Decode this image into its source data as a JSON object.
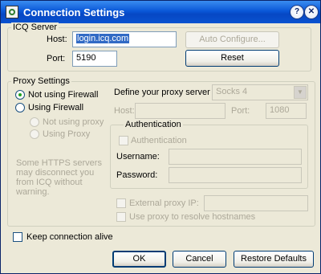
{
  "window": {
    "title": "Connection Settings",
    "help_glyph": "?",
    "close_glyph": "✕"
  },
  "icq_server": {
    "legend": "ICQ Server",
    "host_label": "Host:",
    "host_value": "login.icq.com",
    "port_label": "Port:",
    "port_value": "5190",
    "auto_configure_label": "Auto Configure...",
    "reset_label": "Reset"
  },
  "proxy_settings": {
    "legend": "Proxy Settings",
    "not_using_firewall": "Not using Firewall",
    "using_firewall": "Using Firewall",
    "not_using_proxy": "Not using proxy",
    "using_proxy": "Using Proxy",
    "note": "Some HTTPS servers may disconnect you from ICQ without warning.",
    "define_label": "Define your proxy server",
    "proxy_type": "Socks 4",
    "host_label": "Host:",
    "host_value": "",
    "port_label": "Port:",
    "port_value": "1080",
    "auth": {
      "legend": "Authentication",
      "checkbox_label": "Authentication",
      "username_label": "Username:",
      "password_label": "Password:"
    },
    "external_proxy_ip_label": "External proxy IP:",
    "use_proxy_resolve_label": "Use proxy to resolve hostnames"
  },
  "keep_alive_label": "Keep connection alive",
  "buttons": {
    "ok": "OK",
    "cancel": "Cancel",
    "restore_defaults": "Restore Defaults"
  },
  "colors": {
    "titlebar": "#0a58d8",
    "window_bg": "#ece9d8",
    "selection": "#316ac5",
    "radio_dot": "#21a121"
  }
}
